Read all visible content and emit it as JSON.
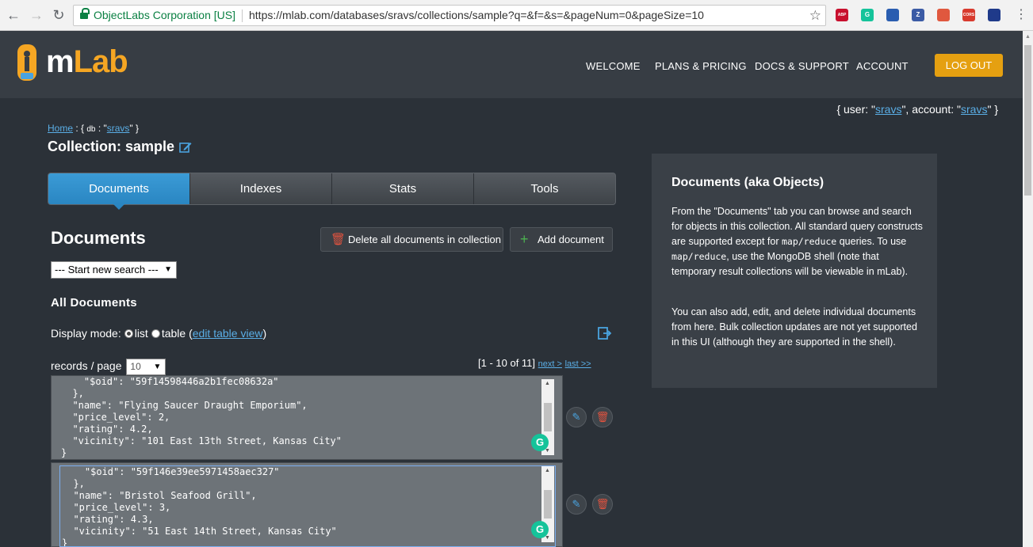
{
  "browser": {
    "org": "ObjectLabs Corporation [US]",
    "url": "https://mlab.com/databases/sravs/collections/sample?q=&f=&s=&pageNum=0&pageSize=10",
    "extensions": [
      {
        "name": "adblock-icon",
        "label": "ABP",
        "color": "#c8102e"
      },
      {
        "name": "grammarly-icon",
        "label": "G",
        "color": "#15c39a"
      },
      {
        "name": "bookmark-ext-icon",
        "label": "",
        "color": "#2a5db0"
      },
      {
        "name": "zotero-icon",
        "label": "Z",
        "color": "#3b5ba5"
      },
      {
        "name": "puzzle-ext-icon",
        "label": "",
        "color": "#e0583e"
      },
      {
        "name": "cors-icon",
        "label": "CORS",
        "color": "#d83a2e"
      },
      {
        "name": "flag-ext-icon",
        "label": "",
        "color": "#1f3a8a"
      }
    ]
  },
  "header": {
    "logo": "mLab",
    "nav": [
      "WELCOME",
      "PLANS & PRICING",
      "DOCS & SUPPORT",
      "ACCOUNT"
    ],
    "logout": "LOG OUT"
  },
  "user_info": {
    "prefix": "{ user: \"",
    "user": "sravs",
    "mid": "\", account: \"",
    "account": "sravs",
    "suffix": "\" }"
  },
  "breadcrumb": {
    "home": "Home",
    "sep": " : { ",
    "db_key": "db",
    "db_mid": " : \"",
    "db": "sravs",
    "db_end": "\" }"
  },
  "collection": {
    "prefix": "Collection: ",
    "name": "sample"
  },
  "tabs": [
    "Documents",
    "Indexes",
    "Stats",
    "Tools"
  ],
  "documents": {
    "heading": "Documents",
    "delete_label": "Delete all documents in collection",
    "add_label": "Add document",
    "search_select": "--- Start new search ---",
    "all_heading": "All Documents",
    "display_mode_label": "Display mode:",
    "mode_list": "list",
    "mode_table": "table (",
    "edit_table_view": "edit table view",
    "mode_close": ")",
    "records_label": "records / page",
    "page_size": "10",
    "range": "[1 - 10 of 11]",
    "next": "next >",
    "last": "last >>"
  },
  "doc_rows": [
    {
      "text": "    \"$oid\": \"59f14598446a2b1fec08632a\"\n  },\n  \"name\": \"Flying Saucer Draught Emporium\",\n  \"price_level\": 2,\n  \"rating\": 4.2,\n  \"vicinity\": \"101 East 13th Street, Kansas City\"\n}"
    },
    {
      "text": "    \"$oid\": \"59f146e39ee5971458aec327\"\n  },\n  \"name\": \"Bristol Seafood Grill\",\n  \"price_level\": 3,\n  \"rating\": 4.3,\n  \"vicinity\": \"51 East 14th Street, Kansas City\"\n}"
    }
  ],
  "side_panel": {
    "title": "Documents (aka Objects)",
    "p1_a": "From the \"Documents\" tab you can browse and search for objects in this collection. All standard query constructs are supported except for ",
    "p1_code1": "map/reduce",
    "p1_b": " queries. To use ",
    "p1_code2": "map/reduce",
    "p1_c": ", use the MongoDB shell (note that temporary result collections will be viewable in mLab).",
    "p2": "You can also add, edit, and delete individual documents from here. Bulk collection updates are not yet supported in this UI (although they are supported in the shell)."
  },
  "colors": {
    "accent": "#2a86c2",
    "logout": "#e5a011",
    "brand": "#f5a623",
    "background": "#2b3138"
  }
}
